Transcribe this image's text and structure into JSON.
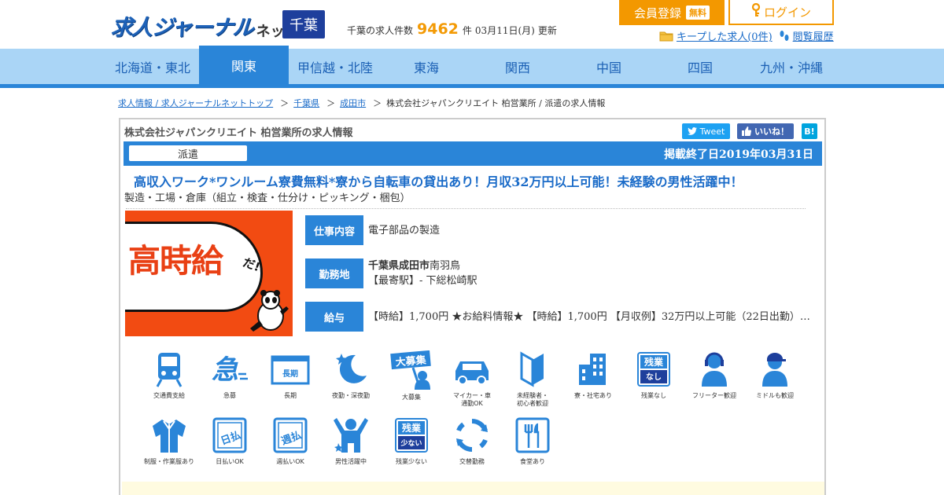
{
  "header": {
    "logo_main": "求人ジャーナル",
    "logo_sub": "ネット",
    "prefecture": "千葉",
    "count_prefix": "千葉の求人件数",
    "count_value": "9462",
    "count_suffix": "件",
    "update_date": "03月11日(月)",
    "update_label": "更新",
    "register_label": "会員登録",
    "register_badge": "無料",
    "login_label": "ログイン",
    "kept_jobs_label": "キープした求人(0件)",
    "history_label": "閲覧履歴"
  },
  "regions": [
    {
      "label": "北海道・東北",
      "active": false
    },
    {
      "label": "関東",
      "active": true
    },
    {
      "label": "甲信越・北陸",
      "active": false
    },
    {
      "label": "東海",
      "active": false
    },
    {
      "label": "関西",
      "active": false
    },
    {
      "label": "中国",
      "active": false
    },
    {
      "label": "四国",
      "active": false
    },
    {
      "label": "九州・沖縄",
      "active": false
    }
  ],
  "breadcrumb": {
    "items": [
      "求人情報 / 求人ジャーナルネットトップ",
      "千葉県",
      "成田市"
    ],
    "current": "株式会社ジャパンクリエイト 柏営業所 / 派遣の求人情報",
    "separator": "＞"
  },
  "job": {
    "company_title": "株式会社ジャパンクリエイト 柏営業所の求人情報",
    "tweet_label": "Tweet",
    "like_label": "いいね！",
    "hatena_label": "B!",
    "employment_type": "派遣",
    "end_date": "掲載終了日2019年03月31日",
    "title": "高収入ワーク*ワンルーム寮費無料*寮から自転車の貸出あり！月収32万円以上可能！未経験の男性活躍中！",
    "category": "製造・工場・倉庫（組立・検査・仕分け・ピッキング・梱包）",
    "image_text": "高時給",
    "image_small": "だ!",
    "work_label": "仕事内容",
    "work_value": "電子部品の製造",
    "location_label": "勤務地",
    "location_bold": "千葉県成田市",
    "location_rest": "南羽鳥",
    "station": "【最寄駅】- 下総松崎駅",
    "salary_label": "給与",
    "salary_value": "【時給】1,700円 ★お給料情報★ 【時給】1,700円 【月収例】32万円以上可能（22日出勤）…"
  },
  "features": [
    {
      "icon": "train-icon",
      "label": "交通費支給"
    },
    {
      "icon": "urgent-icon",
      "label": "急募"
    },
    {
      "icon": "long-term-icon",
      "label": "長期",
      "text": "長期"
    },
    {
      "icon": "night-shift-icon",
      "label": "夜勤・深夜勤"
    },
    {
      "icon": "mass-hiring-icon",
      "label": "大募集",
      "text": "大募集"
    },
    {
      "icon": "car-icon",
      "label": "マイカー・車\n通勤OK"
    },
    {
      "icon": "beginner-mark-icon",
      "label": "未経験者・\n初心者歓迎"
    },
    {
      "icon": "dormitory-icon",
      "label": "寮・社宅あり"
    },
    {
      "icon": "no-overtime-icon",
      "label": "残業なし",
      "text": "残業",
      "text2": "なし"
    },
    {
      "icon": "headset-person-icon",
      "label": "フリーター歓迎"
    },
    {
      "icon": "cap-person-icon",
      "label": "ミドルも歓迎"
    },
    {
      "icon": "uniform-icon",
      "label": "制服・作業服あり"
    },
    {
      "icon": "daily-pay-icon",
      "label": "日払いOK",
      "text": "日払"
    },
    {
      "icon": "weekly-pay-icon",
      "label": "週払いOK",
      "text": "週払"
    },
    {
      "icon": "men-active-icon",
      "label": "男性活躍中"
    },
    {
      "icon": "little-overtime-icon",
      "label": "残業少ない",
      "text": "残業",
      "text2": "少ない"
    },
    {
      "icon": "rotation-icon",
      "label": "交替勤務"
    },
    {
      "icon": "cafeteria-icon",
      "label": "食堂あり"
    }
  ],
  "colors": {
    "brand_blue": "#2a85d8",
    "nav_light": "#aad5f6",
    "orange": "#f39800",
    "pref_badge": "#1e3f9c"
  }
}
